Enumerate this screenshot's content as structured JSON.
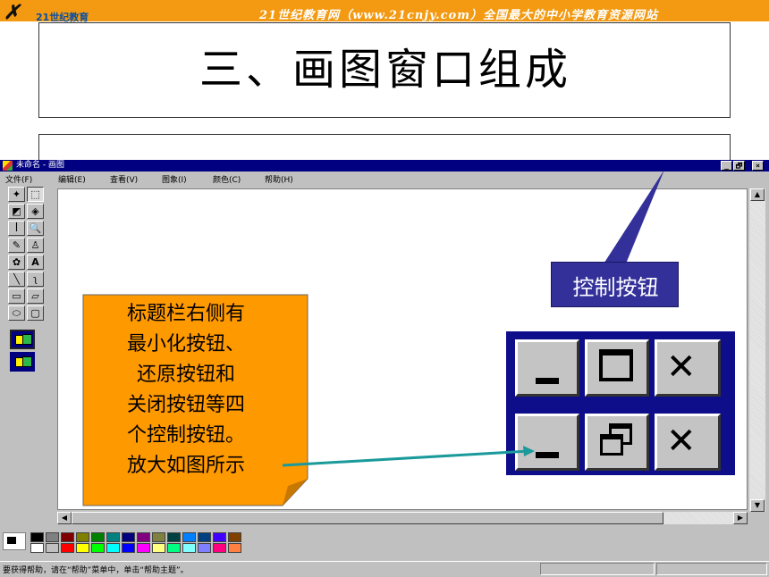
{
  "banner": {
    "logo_text": "21世纪教育",
    "site_text": "21世纪教育网（www.21cnjy.com）全国最大的中小学教育资源网站"
  },
  "slide": {
    "title": "三、画图窗口组成"
  },
  "paint_window": {
    "title": "未命名 - 画图",
    "title_buttons": [
      "_",
      "🗗",
      "×"
    ],
    "menus": [
      "文件(F)",
      "编辑(E)",
      "查看(V)",
      "图象(I)",
      "颜色(C)",
      "帮助(H)"
    ],
    "tools": [
      "✦",
      "⬚",
      "◩",
      "◈",
      "ꟾ",
      "🔍",
      "✎",
      "♙",
      "✿",
      "A",
      "╲",
      "ʅ",
      "▭",
      "▱",
      "⬭",
      "▢"
    ],
    "status_text": "要获得帮助，请在“帮助”菜单中，单击“帮助主题”。",
    "palette_top": [
      "#000000",
      "#808080",
      "#800000",
      "#808000",
      "#008000",
      "#008080",
      "#000080",
      "#800080",
      "#808040",
      "#004040",
      "#0080ff",
      "#004080",
      "#4000ff",
      "#804000"
    ],
    "palette_bottom": [
      "#ffffff",
      "#c0c0c0",
      "#ff0000",
      "#ffff00",
      "#00ff00",
      "#00ffff",
      "#0000ff",
      "#ff00ff",
      "#ffff80",
      "#00ff80",
      "#80ffff",
      "#8080ff",
      "#ff0080",
      "#ff8040"
    ]
  },
  "callouts": {
    "control_buttons_label": "控制按钮",
    "note_lines": [
      "标题栏右侧有",
      "最小化按钮、",
      "还原按钮和",
      "关闭按钮等四",
      "个控制按钮。",
      "放大如图所示"
    ]
  },
  "colors": {
    "banner": "#f39a12",
    "titlebar": "#000080",
    "callout_bg": "#33309a",
    "note_bg": "#ff9900",
    "arrow": "#1a9a9a"
  }
}
